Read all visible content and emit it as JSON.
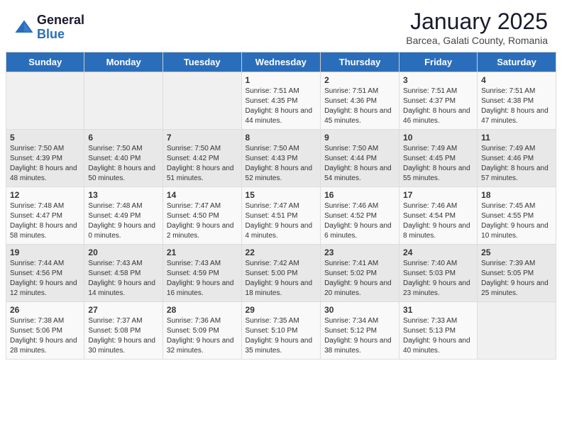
{
  "logo": {
    "general": "General",
    "blue": "Blue"
  },
  "title": "January 2025",
  "subtitle": "Barcea, Galati County, Romania",
  "days_of_week": [
    "Sunday",
    "Monday",
    "Tuesday",
    "Wednesday",
    "Thursday",
    "Friday",
    "Saturday"
  ],
  "weeks": [
    [
      {
        "day": "",
        "info": ""
      },
      {
        "day": "",
        "info": ""
      },
      {
        "day": "",
        "info": ""
      },
      {
        "day": "1",
        "info": "Sunrise: 7:51 AM\nSunset: 4:35 PM\nDaylight: 8 hours and 44 minutes."
      },
      {
        "day": "2",
        "info": "Sunrise: 7:51 AM\nSunset: 4:36 PM\nDaylight: 8 hours and 45 minutes."
      },
      {
        "day": "3",
        "info": "Sunrise: 7:51 AM\nSunset: 4:37 PM\nDaylight: 8 hours and 46 minutes."
      },
      {
        "day": "4",
        "info": "Sunrise: 7:51 AM\nSunset: 4:38 PM\nDaylight: 8 hours and 47 minutes."
      }
    ],
    [
      {
        "day": "5",
        "info": "Sunrise: 7:50 AM\nSunset: 4:39 PM\nDaylight: 8 hours and 48 minutes."
      },
      {
        "day": "6",
        "info": "Sunrise: 7:50 AM\nSunset: 4:40 PM\nDaylight: 8 hours and 50 minutes."
      },
      {
        "day": "7",
        "info": "Sunrise: 7:50 AM\nSunset: 4:42 PM\nDaylight: 8 hours and 51 minutes."
      },
      {
        "day": "8",
        "info": "Sunrise: 7:50 AM\nSunset: 4:43 PM\nDaylight: 8 hours and 52 minutes."
      },
      {
        "day": "9",
        "info": "Sunrise: 7:50 AM\nSunset: 4:44 PM\nDaylight: 8 hours and 54 minutes."
      },
      {
        "day": "10",
        "info": "Sunrise: 7:49 AM\nSunset: 4:45 PM\nDaylight: 8 hours and 55 minutes."
      },
      {
        "day": "11",
        "info": "Sunrise: 7:49 AM\nSunset: 4:46 PM\nDaylight: 8 hours and 57 minutes."
      }
    ],
    [
      {
        "day": "12",
        "info": "Sunrise: 7:48 AM\nSunset: 4:47 PM\nDaylight: 8 hours and 58 minutes."
      },
      {
        "day": "13",
        "info": "Sunrise: 7:48 AM\nSunset: 4:49 PM\nDaylight: 9 hours and 0 minutes."
      },
      {
        "day": "14",
        "info": "Sunrise: 7:47 AM\nSunset: 4:50 PM\nDaylight: 9 hours and 2 minutes."
      },
      {
        "day": "15",
        "info": "Sunrise: 7:47 AM\nSunset: 4:51 PM\nDaylight: 9 hours and 4 minutes."
      },
      {
        "day": "16",
        "info": "Sunrise: 7:46 AM\nSunset: 4:52 PM\nDaylight: 9 hours and 6 minutes."
      },
      {
        "day": "17",
        "info": "Sunrise: 7:46 AM\nSunset: 4:54 PM\nDaylight: 9 hours and 8 minutes."
      },
      {
        "day": "18",
        "info": "Sunrise: 7:45 AM\nSunset: 4:55 PM\nDaylight: 9 hours and 10 minutes."
      }
    ],
    [
      {
        "day": "19",
        "info": "Sunrise: 7:44 AM\nSunset: 4:56 PM\nDaylight: 9 hours and 12 minutes."
      },
      {
        "day": "20",
        "info": "Sunrise: 7:43 AM\nSunset: 4:58 PM\nDaylight: 9 hours and 14 minutes."
      },
      {
        "day": "21",
        "info": "Sunrise: 7:43 AM\nSunset: 4:59 PM\nDaylight: 9 hours and 16 minutes."
      },
      {
        "day": "22",
        "info": "Sunrise: 7:42 AM\nSunset: 5:00 PM\nDaylight: 9 hours and 18 minutes."
      },
      {
        "day": "23",
        "info": "Sunrise: 7:41 AM\nSunset: 5:02 PM\nDaylight: 9 hours and 20 minutes."
      },
      {
        "day": "24",
        "info": "Sunrise: 7:40 AM\nSunset: 5:03 PM\nDaylight: 9 hours and 23 minutes."
      },
      {
        "day": "25",
        "info": "Sunrise: 7:39 AM\nSunset: 5:05 PM\nDaylight: 9 hours and 25 minutes."
      }
    ],
    [
      {
        "day": "26",
        "info": "Sunrise: 7:38 AM\nSunset: 5:06 PM\nDaylight: 9 hours and 28 minutes."
      },
      {
        "day": "27",
        "info": "Sunrise: 7:37 AM\nSunset: 5:08 PM\nDaylight: 9 hours and 30 minutes."
      },
      {
        "day": "28",
        "info": "Sunrise: 7:36 AM\nSunset: 5:09 PM\nDaylight: 9 hours and 32 minutes."
      },
      {
        "day": "29",
        "info": "Sunrise: 7:35 AM\nSunset: 5:10 PM\nDaylight: 9 hours and 35 minutes."
      },
      {
        "day": "30",
        "info": "Sunrise: 7:34 AM\nSunset: 5:12 PM\nDaylight: 9 hours and 38 minutes."
      },
      {
        "day": "31",
        "info": "Sunrise: 7:33 AM\nSunset: 5:13 PM\nDaylight: 9 hours and 40 minutes."
      },
      {
        "day": "",
        "info": ""
      }
    ]
  ]
}
